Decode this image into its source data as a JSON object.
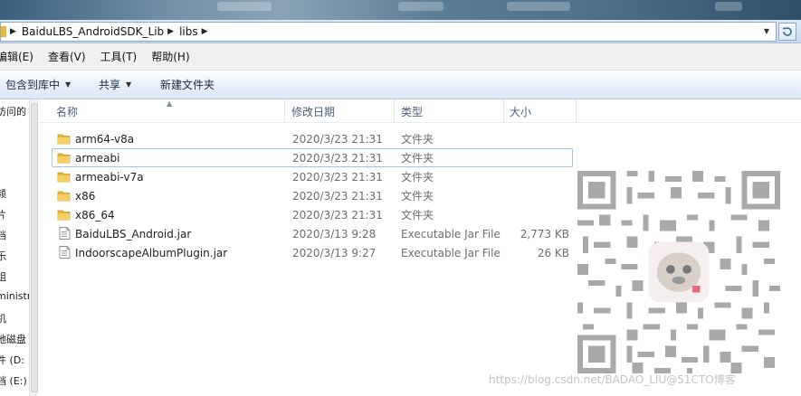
{
  "address": {
    "crumbs": [
      "BaiduLBS_AndroidSDK_Lib",
      "libs"
    ],
    "refresh_icon": "refresh-icon"
  },
  "menu": {
    "items": [
      "编辑(E)",
      "查看(V)",
      "工具(T)",
      "帮助(H)"
    ]
  },
  "toolbar": {
    "include_label": "包含到库中",
    "share_label": "共享",
    "new_folder_label": "新建文件夹"
  },
  "navigation": {
    "items": [
      "访问的",
      "频",
      "片",
      "档",
      "乐",
      "组",
      "ministr",
      "机",
      "地磁盘",
      "件 (D:",
      "档 (E:)"
    ]
  },
  "columns": {
    "name": "名称",
    "date": "修改日期",
    "type": "类型",
    "size": "大小"
  },
  "files": [
    {
      "name": "arm64-v8a",
      "date": "2020/3/23 21:31",
      "type": "文件夹",
      "size": "",
      "icon": "folder-icon"
    },
    {
      "name": "armeabi",
      "date": "2020/3/23 21:31",
      "type": "文件夹",
      "size": "",
      "icon": "folder-icon"
    },
    {
      "name": "armeabi-v7a",
      "date": "2020/3/23 21:31",
      "type": "文件夹",
      "size": "",
      "icon": "folder-icon"
    },
    {
      "name": "x86",
      "date": "2020/3/23 21:31",
      "type": "文件夹",
      "size": "",
      "icon": "folder-icon"
    },
    {
      "name": "x86_64",
      "date": "2020/3/23 21:31",
      "type": "文件夹",
      "size": "",
      "icon": "folder-icon"
    },
    {
      "name": "BaiduLBS_Android.jar",
      "date": "2020/3/13 9:28",
      "type": "Executable Jar File",
      "size": "2,773 KB",
      "icon": "jar-file-icon"
    },
    {
      "name": "IndoorscapeAlbumPlugin.jar",
      "date": "2020/3/13 9:27",
      "type": "Executable Jar File",
      "size": "26 KB",
      "icon": "jar-file-icon"
    }
  ],
  "watermark": "https://blog.csdn.net/BADAO_LIU@51CTO博客",
  "colors": {
    "selection_border": "#99c8ef",
    "folder": "#e8b73a",
    "header_text": "#4c607a"
  }
}
